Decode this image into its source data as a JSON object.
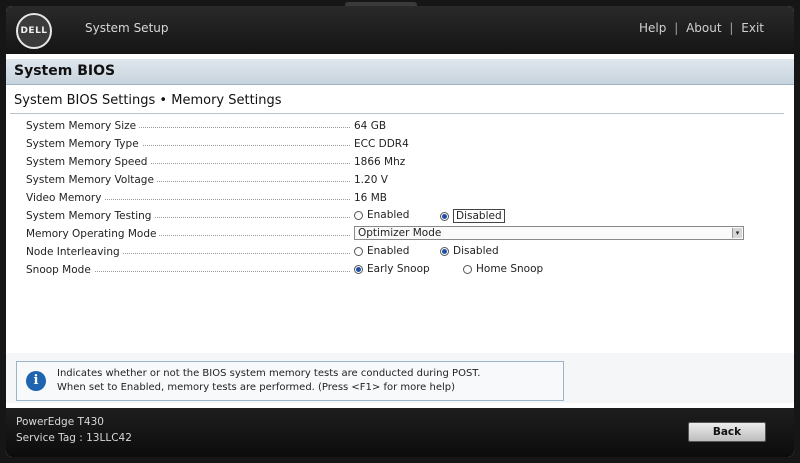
{
  "header": {
    "logo_text": "DELL",
    "app_title": "System Setup",
    "links": [
      "Help",
      "About",
      "Exit"
    ],
    "separator": "|"
  },
  "section": {
    "title": "System BIOS"
  },
  "page": {
    "title": "System BIOS Settings • Memory Settings"
  },
  "settings": {
    "memory_size": {
      "label": "System Memory Size",
      "value": "64 GB"
    },
    "memory_type": {
      "label": "System Memory Type",
      "value": "ECC DDR4"
    },
    "memory_speed": {
      "label": "System Memory Speed",
      "value": "1866 Mhz"
    },
    "memory_voltage": {
      "label": "System Memory Voltage",
      "value": "1.20 V"
    },
    "video_memory": {
      "label": "Video Memory",
      "value": "16 MB"
    },
    "memory_testing": {
      "label": "System Memory Testing",
      "option_enabled": "Enabled",
      "option_disabled": "Disabled",
      "selected": "Disabled"
    },
    "operating_mode": {
      "label": "Memory Operating Mode",
      "value": "Optimizer Mode"
    },
    "node_interleaving": {
      "label": "Node Interleaving",
      "option_enabled": "Enabled",
      "option_disabled": "Disabled",
      "selected": "Disabled"
    },
    "snoop_mode": {
      "label": "Snoop Mode",
      "option_early": "Early Snoop",
      "option_home": "Home Snoop",
      "selected": "Early Snoop"
    }
  },
  "help": {
    "line1": "Indicates whether or not the BIOS system memory tests are conducted during POST.",
    "line2": "When set to Enabled, memory tests are performed. (Press <F1> for more help)"
  },
  "footer": {
    "model": "PowerEdge T430",
    "service_tag": "Service Tag : 13LLC42",
    "back_label": "Back"
  },
  "colors": {
    "accent": "#1e64b0",
    "header_bg": "#1a1a1a",
    "band_bg": "#d3dde6"
  }
}
